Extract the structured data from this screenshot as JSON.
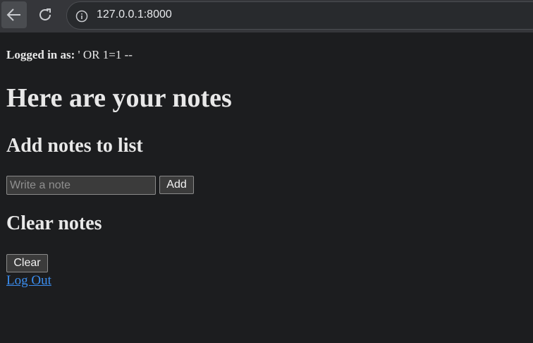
{
  "browser": {
    "url": "127.0.0.1:8000",
    "icons": [
      "back-arrow-icon",
      "reload-icon",
      "info-icon"
    ]
  },
  "page": {
    "logged_in_label": "Logged in as:",
    "logged_in_user": " ' OR 1=1 --",
    "title": "Here are your notes",
    "add_heading": "Add notes to list",
    "note_placeholder": "Write a note",
    "add_button": "Add",
    "clear_heading": "Clear notes",
    "clear_button": "Clear",
    "logout_link": "Log Out"
  }
}
